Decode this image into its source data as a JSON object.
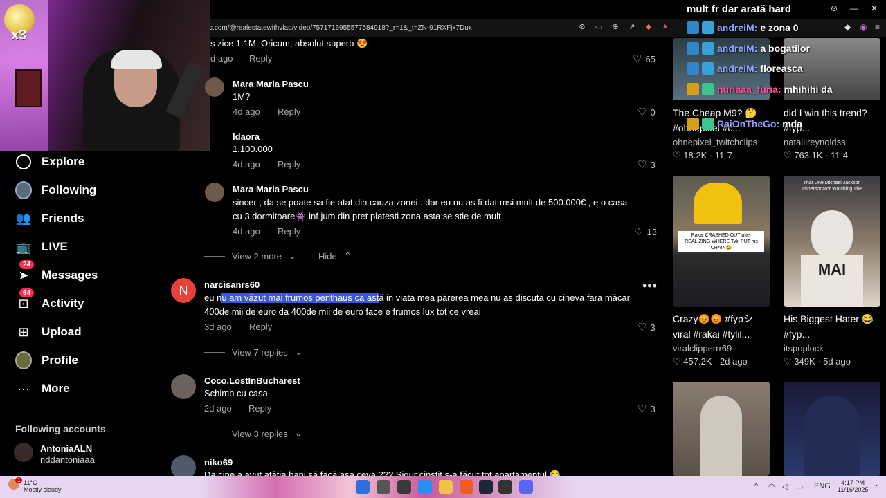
{
  "browser": {
    "url": "c.com/@realestatewithvlad/video/7571716955577584918?_r=1&_t=ZN-91RXFjx7Dux",
    "window_title": "mult fr dar arată hard"
  },
  "webcam": {
    "badge_text": "x3"
  },
  "sidebar": {
    "items": [
      {
        "label": "Explore",
        "icon": "compass-icon"
      },
      {
        "label": "Following",
        "icon": "following-avatar"
      },
      {
        "label": "Friends",
        "icon": "friends-icon"
      },
      {
        "label": "LIVE",
        "icon": "live-tv-icon"
      },
      {
        "label": "Messages",
        "icon": "send-icon",
        "badge": "24"
      },
      {
        "label": "Activity",
        "icon": "inbox-icon",
        "badge": "64"
      },
      {
        "label": "Upload",
        "icon": "plus-square-icon"
      },
      {
        "label": "Profile",
        "icon": "profile-avatar"
      },
      {
        "label": "More",
        "icon": "ellipsis-icon"
      }
    ],
    "following_title": "Following accounts",
    "following_accounts": [
      {
        "name": "AntoniaALN",
        "handle": "nddantoniaaa"
      }
    ]
  },
  "comments": {
    "top": {
      "text": "ș zice 1.1M. Oricum, absolut superb 😍",
      "time": "d ago",
      "reply": "Reply",
      "likes": "65"
    },
    "reply1": {
      "user": "Mara Maria Pascu",
      "text": "1M?",
      "time": "4d ago",
      "reply": "Reply",
      "likes": "0"
    },
    "reply2": {
      "user": "Idaora",
      "text": "1.100.000",
      "time": "4d ago",
      "reply": "Reply",
      "likes": "3"
    },
    "reply3": {
      "user": "Mara Maria Pascu",
      "text1": "sincer , da se poate sa fie atat din cauza zonei.. dar eu nu as fi dat msi mult de 500.000€ , e o casa",
      "text2": "cu 3 dormitoare👾 inf jum din pret platesti zona asta se stie de mult",
      "time": "4d ago",
      "reply": "Reply",
      "likes": "13"
    },
    "view_more": "View 2 more",
    "hide": "Hide",
    "c2": {
      "avatar_letter": "N",
      "user": "narcisanrs60",
      "text_pre": "eu n",
      "text_hl": "u am văzut mai frumos penthaus ca ast",
      "text_post": "ă in viata mea părerea mea nu as discuta cu cineva fara măcar",
      "text2": "400de mii de euro da 400de mii de euro face e frumos lux tot ce vreai",
      "time": "3d ago",
      "reply": "Reply",
      "likes": "3",
      "more": "•••"
    },
    "c2_view": "View 7 replies",
    "c3": {
      "user": "Coco.LostInBucharest",
      "text": "Schimb cu casa",
      "time": "2d ago",
      "reply": "Reply",
      "likes": "3"
    },
    "c3_view": "View 3 replies",
    "c4": {
      "user": "niko69",
      "text": "Da cine a avut atâtia bani să facă așa ceva ??? Sigur cinstit s-a făcut tot apartamentul 😂"
    }
  },
  "videos": [
    {
      "caption1": "The Cheap M9? 🤔",
      "caption2": "#ohnepixel #c...",
      "author": "ohnepixel_twitchclips",
      "stats": "♡ 18.2K · 11-7"
    },
    {
      "caption1": "did I win this trend?",
      "caption2": "#fyp...",
      "author": "nataliireynoldss",
      "stats": "♡ 763.1K · 11-4"
    },
    {
      "caption1": "Crazy😡😡 #fypシ",
      "caption2": "viral #rakai #tylil...",
      "author": "viralclipperrr69",
      "stats": "♡ 457.2K · 2d ago",
      "overlay": "Rakai CRASHED OUT after REALIZING WHERE Tylil PUT his CHAIN😂"
    },
    {
      "caption1": "His Biggest Hater 😂",
      "caption2": "#fyp...",
      "author": "itspoplock",
      "stats": "♡ 349K · 5d ago",
      "overlay": "That One Michael Jackson Impersonator Watching The"
    },
    {
      "caption1": "",
      "caption2": "",
      "author": "",
      "stats": ""
    },
    {
      "caption1": "",
      "caption2": "",
      "author": "",
      "stats": ""
    }
  ],
  "chat": [
    {
      "name": "andreiM:",
      "msg": "e zona 0"
    },
    {
      "name": "andreiM:",
      "msg": "a bogatilor"
    },
    {
      "name": "andreiM:",
      "msg": "floreasca"
    },
    {
      "name": "nuriaaa_furia:",
      "msg": "mhihihi da"
    },
    {
      "name": "RaiOnTheGo:",
      "msg": "mda"
    }
  ],
  "taskbar": {
    "temp": "11°C",
    "weather": "Mostly cloudy",
    "time": "4:17 PM",
    "date": "11/16/2025",
    "notif": "1"
  },
  "colors": {
    "accent": "#fe2c55",
    "highlight": "#3a57d6",
    "chat_name": "#8ea4ff"
  }
}
